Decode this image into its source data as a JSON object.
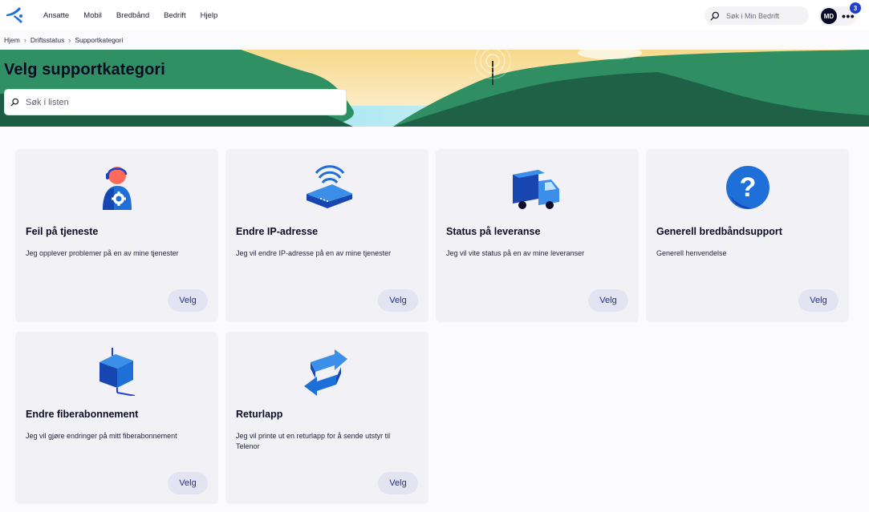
{
  "nav": {
    "links": [
      "Ansatte",
      "Mobil",
      "Bredbånd",
      "Bedrift",
      "Hjelp"
    ],
    "search_placeholder": "Søk i Min Bedrift",
    "avatar_initials": "MD",
    "notification_count": "3",
    "more_icon": "more-dots-icon"
  },
  "breadcrumb": {
    "items": [
      "Hjem",
      "Driftsstatus",
      "Supportkategori"
    ]
  },
  "hero": {
    "title": "Velg supportkategori",
    "search_placeholder": "Søk i listen"
  },
  "cards": [
    {
      "title": "Feil på tjeneste",
      "description": "Jeg opplever problemer på en av mine tjenester",
      "button": "Velg",
      "icon": "support-agent-icon"
    },
    {
      "title": "Endre IP-adresse",
      "description": "Jeg vil endre IP-adresse på en av mine tjenester",
      "button": "Velg",
      "icon": "router-icon"
    },
    {
      "title": "Status på leveranse",
      "description": "Jeg vil vite status på en av mine leveranser",
      "button": "Velg",
      "icon": "delivery-truck-icon"
    },
    {
      "title": "Generell bredbåndsupport",
      "description": "Generell henvendelse",
      "button": "Velg",
      "icon": "question-mark-icon"
    },
    {
      "title": "Endre fiberabonnement",
      "description": "Jeg vil gjøre endringer på mitt fiberabonnement",
      "button": "Velg",
      "icon": "house-fiber-icon"
    },
    {
      "title": "Returlapp",
      "description": "Jeg vil printe ut en returlapp for å sende utstyr til Telenor",
      "button": "Velg",
      "icon": "return-arrows-icon"
    }
  ],
  "colors": {
    "brand_blue": "#1f3fcd",
    "hero_green": "#2e8a5e",
    "card_bg": "#f2f2f6",
    "button_bg": "#e3e4f2"
  }
}
